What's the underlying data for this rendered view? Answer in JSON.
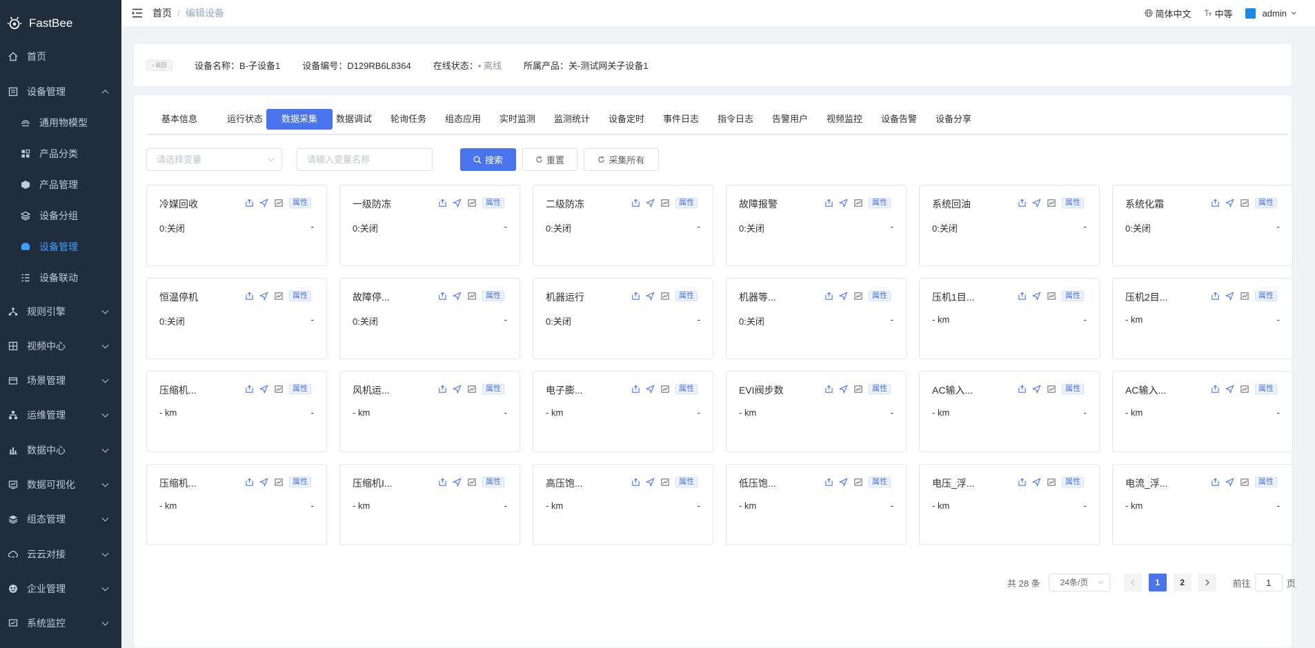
{
  "app": {
    "brand": "FastBee"
  },
  "sidebar": {
    "items": [
      {
        "label": "首页",
        "icon": "home-icon",
        "top": 0
      },
      {
        "label": "设备管理",
        "icon": "device-icon",
        "expanded": true
      },
      {
        "label": "通用物模型",
        "icon": "model-icon",
        "sub": true
      },
      {
        "label": "产品分类",
        "icon": "category-icon",
        "sub": true
      },
      {
        "label": "产品管理",
        "icon": "product-icon",
        "sub": true
      },
      {
        "label": "设备分组",
        "icon": "group-icon",
        "sub": true
      },
      {
        "label": "设备管理",
        "icon": "device-manage-icon",
        "sub": true,
        "active": true
      },
      {
        "label": "设备联动",
        "icon": "linkage-icon",
        "sub": true
      },
      {
        "label": "规则引擎",
        "icon": "rule-icon",
        "collapsed": true
      },
      {
        "label": "视频中心",
        "icon": "video-icon",
        "collapsed": true
      },
      {
        "label": "场景管理",
        "icon": "scene-icon",
        "collapsed": true
      },
      {
        "label": "运维管理",
        "icon": "ops-icon",
        "collapsed": true
      },
      {
        "label": "数据中心",
        "icon": "data-center-icon",
        "collapsed": true
      },
      {
        "label": "数据可视化",
        "icon": "visualization-icon",
        "collapsed": true
      },
      {
        "label": "组态管理",
        "icon": "configuration-icon",
        "collapsed": true
      },
      {
        "label": "云云对接",
        "icon": "cloud-icon",
        "collapsed": true
      },
      {
        "label": "企业管理",
        "icon": "enterprise-icon",
        "collapsed": true
      },
      {
        "label": "系统监控",
        "icon": "monitor-icon",
        "collapsed": true
      }
    ]
  },
  "navbar": {
    "breadcrumb_home": "首页",
    "breadcrumb_sep": "/",
    "breadcrumb_current": "编辑设备",
    "language": "简体中文",
    "size": "中等",
    "user": "admin"
  },
  "device": {
    "back_label": "返回",
    "name": "设备名称：B-子设备1",
    "serial": "设备编号：D129RB6L8364",
    "status_label": "在线状态：",
    "status_dot": "•",
    "status_value": "离线",
    "product": "所属产品：关-测试网关子设备1"
  },
  "tabs": [
    "基本信息",
    "运行状态",
    "数据采集",
    "数据调试",
    "轮询任务",
    "组态应用",
    "实时监测",
    "监测统计",
    "设备定时",
    "事件日志",
    "指令日志",
    "告警用户",
    "视频监控",
    "设备告警",
    "设备分享"
  ],
  "active_tab": 2,
  "filters": {
    "select_placeholder": "请选择变量",
    "input_placeholder": "请输入变量名称",
    "search_label": "搜索",
    "reset_label": "重置",
    "collect_all_label": "采集所有"
  },
  "cards": [
    {
      "name": "冷媒回收",
      "value": "0:关闭",
      "unit": "-"
    },
    {
      "name": "一级防冻",
      "value": "0:关闭",
      "unit": "-"
    },
    {
      "name": "二级防冻",
      "value": "0:关闭",
      "unit": "-"
    },
    {
      "name": "故障报警",
      "value": "0:关闭",
      "unit": "-"
    },
    {
      "name": "系统回油",
      "value": "0:关闭",
      "unit": "-"
    },
    {
      "name": "系统化霜",
      "value": "0:关闭",
      "unit": "-"
    },
    {
      "name": "恒温停机",
      "value": "0:关闭",
      "unit": "-"
    },
    {
      "name": "故障停...",
      "value": "0:关闭",
      "unit": "-"
    },
    {
      "name": "机器运行",
      "value": "0:关闭",
      "unit": "-"
    },
    {
      "name": "机器等...",
      "value": "0:关闭",
      "unit": "-"
    },
    {
      "name": "压机1目...",
      "value": "- km",
      "unit": "-"
    },
    {
      "name": "压机2目...",
      "value": "- km",
      "unit": "-"
    },
    {
      "name": "压缩机...",
      "value": "- km",
      "unit": "-"
    },
    {
      "name": "风机运...",
      "value": "- km",
      "unit": "-"
    },
    {
      "name": "电子膨...",
      "value": "- km",
      "unit": "-"
    },
    {
      "name": "EVI阀步数",
      "value": "- km",
      "unit": "-"
    },
    {
      "name": "AC输入...",
      "value": "- km",
      "unit": "-"
    },
    {
      "name": "AC输入...",
      "value": "- km",
      "unit": "-"
    },
    {
      "name": "压缩机...",
      "value": "- km",
      "unit": "-"
    },
    {
      "name": "压缩机I...",
      "value": "- km",
      "unit": "-"
    },
    {
      "name": "高压饱...",
      "value": "- km",
      "unit": "-"
    },
    {
      "name": "低压饱...",
      "value": "- km",
      "unit": "-"
    },
    {
      "name": "电压_浮...",
      "value": "- km",
      "unit": "-"
    },
    {
      "name": "电流_浮...",
      "value": "- km",
      "unit": "-"
    }
  ],
  "card_tag": "属性",
  "pagination": {
    "total": "共 28 条",
    "page_size": "24条/页",
    "pages": [
      "1",
      "2"
    ],
    "current": "1",
    "goto_label": "前往",
    "goto_value": "1",
    "page_suffix": "页"
  },
  "colors": {
    "sidebar_bg": "#1f2d3d",
    "primary": "#4a74ee",
    "active_menu": "#409eff"
  }
}
